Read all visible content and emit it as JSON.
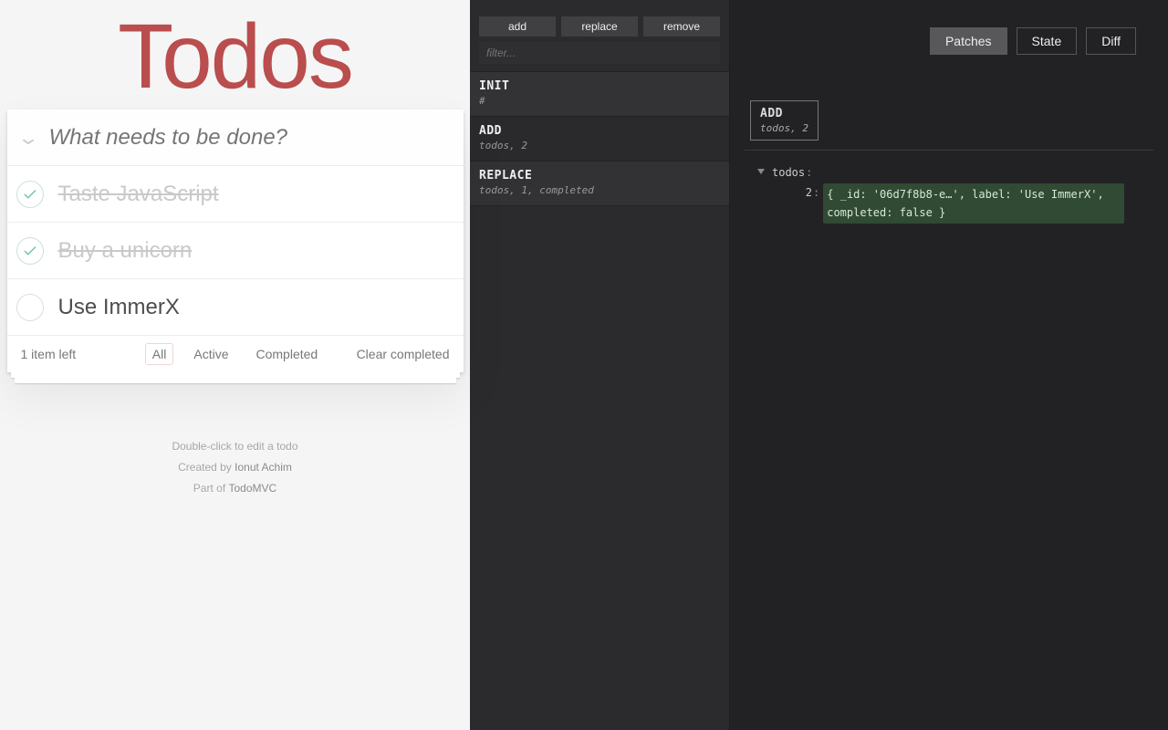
{
  "todo": {
    "title": "Todos",
    "placeholder": "What needs to be done?",
    "items": [
      {
        "label": "Taste JavaScript",
        "completed": true
      },
      {
        "label": "Buy a unicorn",
        "completed": true
      },
      {
        "label": "Use ImmerX",
        "completed": false
      }
    ],
    "items_left_label": "1 item left",
    "filters": {
      "all": "All",
      "active": "Active",
      "completed": "Completed",
      "selected": "all"
    },
    "clear_label": "Clear completed",
    "info": {
      "hint": "Double-click to edit a todo",
      "created_prefix": "Created by ",
      "created_link": "Ionut Achim",
      "partof_prefix": "Part of ",
      "partof_link": "TodoMVC"
    }
  },
  "log": {
    "buttons": {
      "add": "add",
      "replace": "replace",
      "remove": "remove"
    },
    "filter_placeholder": "filter...",
    "entries": [
      {
        "op": "INIT",
        "path": "#",
        "kind": "init"
      },
      {
        "op": "ADD",
        "path": "todos, 2",
        "kind": "add",
        "selected": true
      },
      {
        "op": "REPLACE",
        "path": "todos, 1, completed",
        "kind": "replace"
      }
    ]
  },
  "inspect": {
    "tabs": {
      "patches": "Patches",
      "state": "State",
      "diff": "Diff",
      "active": "patches"
    },
    "chip": {
      "op": "ADD",
      "path": "todos, 2"
    },
    "tree": {
      "root_key": "todos",
      "index": "2",
      "value_text": "{ _id: '06d7f8b8-e…', label: 'Use ImmerX', completed: false }"
    }
  }
}
